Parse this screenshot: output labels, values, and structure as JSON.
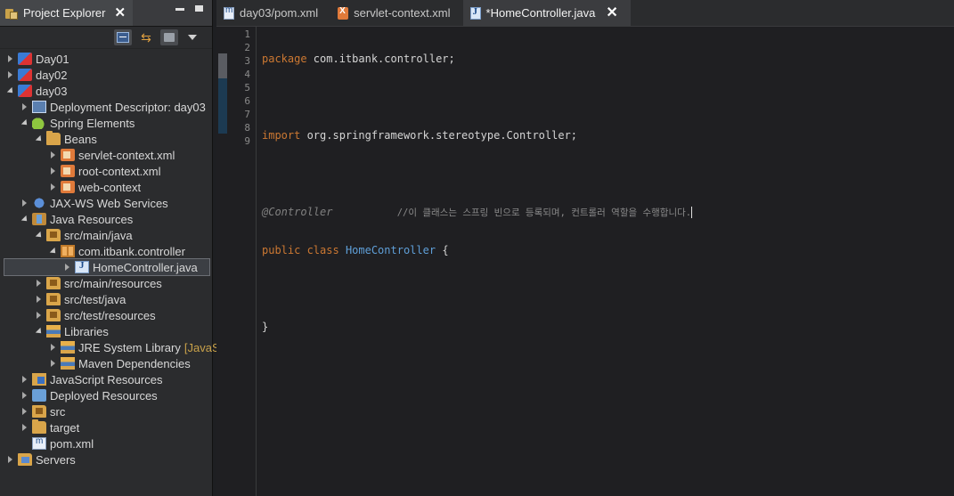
{
  "explorer": {
    "title": "Project Explorer",
    "close_glyph": "✕",
    "tree": [
      {
        "indent": 0,
        "tw": "closed",
        "icon": "i-project",
        "name": "project-day01",
        "label": "Day01"
      },
      {
        "indent": 0,
        "tw": "closed",
        "icon": "i-project",
        "name": "project-day02",
        "label": "day02"
      },
      {
        "indent": 0,
        "tw": "open",
        "icon": "i-project",
        "name": "project-day03",
        "label": "day03"
      },
      {
        "indent": 1,
        "tw": "closed",
        "icon": "i-dd",
        "name": "deployment-descriptor",
        "label": "Deployment Descriptor: day03"
      },
      {
        "indent": 1,
        "tw": "open",
        "icon": "i-spring",
        "name": "spring-elements",
        "label": "Spring Elements"
      },
      {
        "indent": 2,
        "tw": "open",
        "icon": "i-folder",
        "name": "beans-folder",
        "label": "Beans"
      },
      {
        "indent": 3,
        "tw": "closed",
        "icon": "i-xmlbean",
        "name": "servlet-context-xml",
        "label": "servlet-context.xml"
      },
      {
        "indent": 3,
        "tw": "closed",
        "icon": "i-xmlbean",
        "name": "root-context-xml",
        "label": "root-context.xml"
      },
      {
        "indent": 3,
        "tw": "closed",
        "icon": "i-xmlbean",
        "name": "web-context",
        "label": "web-context"
      },
      {
        "indent": 1,
        "tw": "closed",
        "icon": "i-ws",
        "name": "jax-ws-web-services",
        "label": "JAX-WS Web Services"
      },
      {
        "indent": 1,
        "tw": "open",
        "icon": "i-javares",
        "name": "java-resources",
        "label": "Java Resources"
      },
      {
        "indent": 2,
        "tw": "open",
        "icon": "i-srcfolder",
        "name": "src-main-java",
        "label": "src/main/java"
      },
      {
        "indent": 3,
        "tw": "open",
        "icon": "i-package",
        "name": "package-controller",
        "label": "com.itbank.controller"
      },
      {
        "indent": 4,
        "tw": "closed",
        "icon": "i-javafile",
        "name": "homecontroller-java",
        "label": "HomeController.java",
        "selected": true
      },
      {
        "indent": 2,
        "tw": "closed",
        "icon": "i-srcfolder",
        "name": "src-main-resources",
        "label": "src/main/resources"
      },
      {
        "indent": 2,
        "tw": "closed",
        "icon": "i-srcfolder",
        "name": "src-test-java",
        "label": "src/test/java"
      },
      {
        "indent": 2,
        "tw": "closed",
        "icon": "i-srcfolder",
        "name": "src-test-resources",
        "label": "src/test/resources"
      },
      {
        "indent": 2,
        "tw": "open",
        "icon": "i-lib",
        "name": "libraries",
        "label": "Libraries"
      },
      {
        "indent": 3,
        "tw": "closed",
        "icon": "i-lib",
        "name": "jre-system-library",
        "label": "JRE System Library",
        "suffix": "[JavaSE"
      },
      {
        "indent": 3,
        "tw": "closed",
        "icon": "i-lib",
        "name": "maven-dependencies",
        "label": "Maven Dependencies"
      },
      {
        "indent": 1,
        "tw": "closed",
        "icon": "i-jsres",
        "name": "javascript-resources",
        "label": "JavaScript Resources"
      },
      {
        "indent": 1,
        "tw": "closed",
        "icon": "i-deployed",
        "name": "deployed-resources",
        "label": "Deployed Resources"
      },
      {
        "indent": 1,
        "tw": "closed",
        "icon": "i-srcfolder",
        "name": "src-folder",
        "label": "src"
      },
      {
        "indent": 1,
        "tw": "closed",
        "icon": "i-folder",
        "name": "target-folder",
        "label": "target"
      },
      {
        "indent": 1,
        "tw": "none",
        "icon": "i-pom",
        "name": "pom-xml",
        "label": "pom.xml"
      },
      {
        "indent": 0,
        "tw": "closed",
        "icon": "i-servers",
        "name": "servers",
        "label": "Servers"
      }
    ]
  },
  "editor": {
    "tabs": [
      {
        "name": "tab-pom-xml",
        "icon": "ti-xml",
        "label": "day03/pom.xml",
        "active": false
      },
      {
        "name": "tab-servlet-context-xml",
        "icon": "ti-xml2",
        "label": "servlet-context.xml",
        "active": false
      },
      {
        "name": "tab-homecontroller-java",
        "icon": "ti-java",
        "label": "*HomeController.java",
        "active": true
      }
    ],
    "line_numbers": [
      "1",
      "2",
      "3",
      "4",
      "5",
      "6",
      "7",
      "8",
      "9"
    ],
    "code": {
      "line1_kw": "package",
      "line1_rest": " com.itbank.controller;",
      "line3_kw": "import",
      "line3_rest": " org.springframework.stereotype.Controller;",
      "line5_ann": "@Controller",
      "line5_gap": "          ",
      "line5_comment": "//이 클래스는 스프링 빈으로 등록되며, 컨트롤러 역할을 수행합니다.",
      "line6_kw": "public class",
      "line6_cls": "HomeController",
      "line6_rest": " {",
      "line8": "}"
    }
  },
  "colors": {
    "keyword": "#cc7832",
    "class": "#5f9fd8",
    "annotation": "#808080"
  }
}
